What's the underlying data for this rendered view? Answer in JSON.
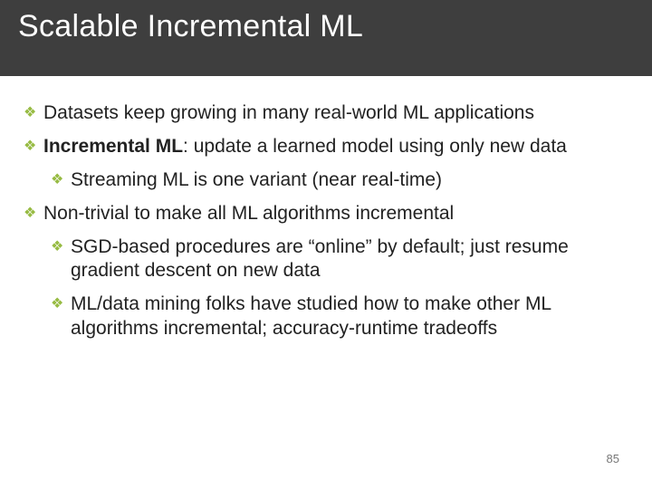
{
  "title": "Scalable Incremental ML",
  "bullets": {
    "b1": "Datasets keep growing in many real-world ML applications",
    "b2_prefix": "Incremental ML",
    "b2_rest": ": update a learned model using only new data",
    "b2_1": "Streaming ML is one variant (near real-time)",
    "b3": "Non-trivial to make all ML algorithms incremental",
    "b3_1": "SGD-based procedures are “online” by default; just resume gradient descent on new data",
    "b3_2": "ML/data mining folks have studied how to make other ML algorithms incremental; accuracy-runtime tradeoffs"
  },
  "page_number": "85"
}
